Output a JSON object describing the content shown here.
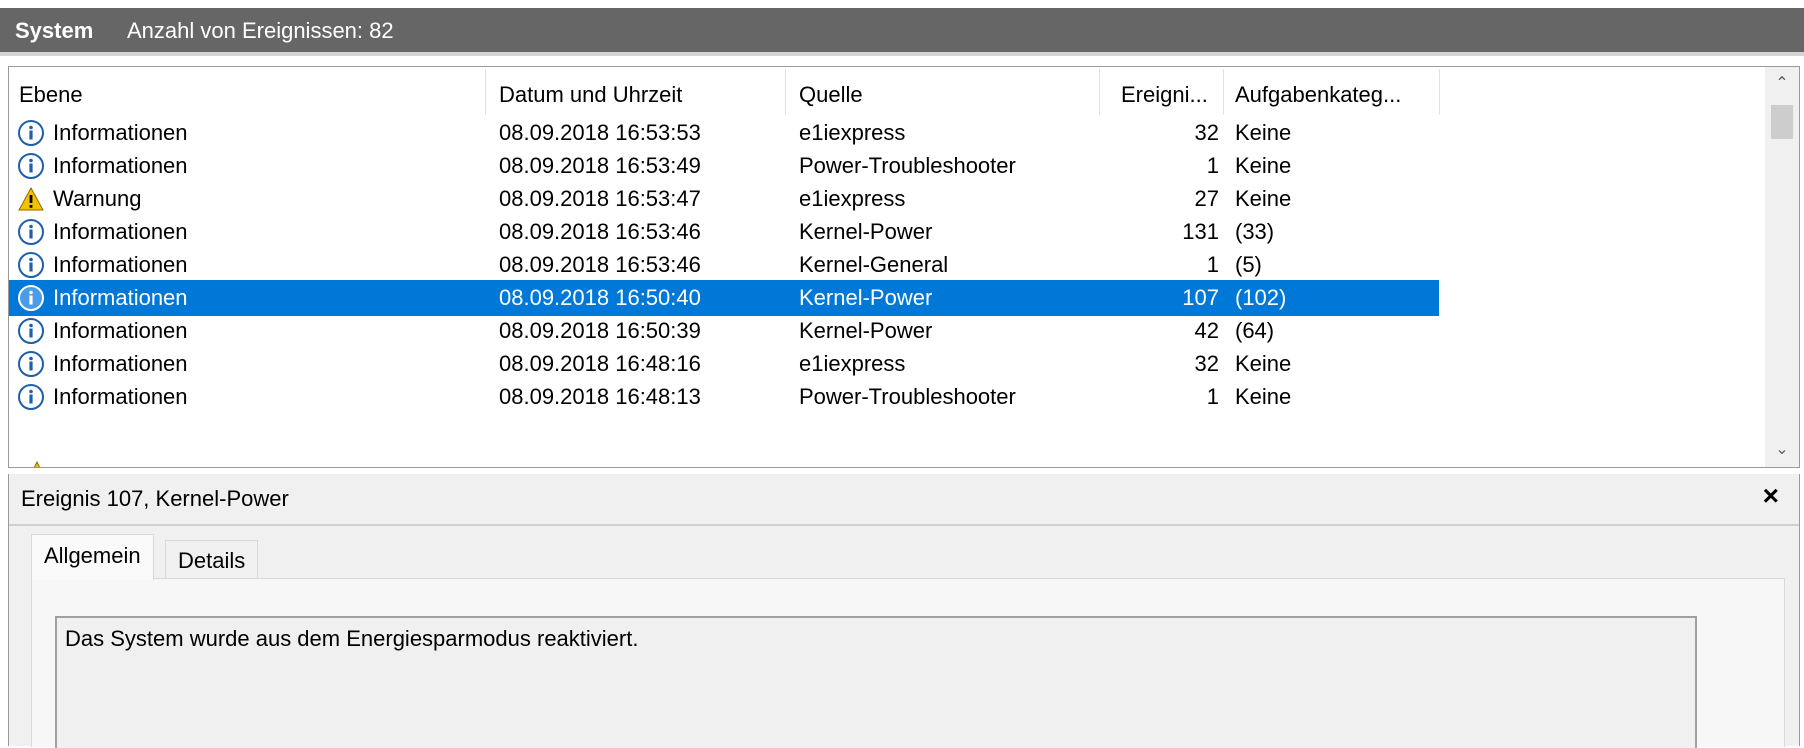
{
  "header": {
    "title": "System",
    "count": "Anzahl von Ereignissen: 82"
  },
  "columns": {
    "level": "Ebene",
    "date": "Datum und Uhrzeit",
    "source": "Quelle",
    "id": "Ereigni...",
    "task": "Aufgabenkateg..."
  },
  "events": [
    {
      "level": "Informationen",
      "date": "08.09.2018 16:53:53",
      "source": "e1iexpress",
      "id": "32",
      "task": "Keine",
      "icon": "info-icon"
    },
    {
      "level": "Informationen",
      "date": "08.09.2018 16:53:49",
      "source": "Power-Troubleshooter",
      "id": "1",
      "task": "Keine",
      "icon": "info-icon"
    },
    {
      "level": "Warnung",
      "date": "08.09.2018 16:53:47",
      "source": "e1iexpress",
      "id": "27",
      "task": "Keine",
      "icon": "warning-icon"
    },
    {
      "level": "Informationen",
      "date": "08.09.2018 16:53:46",
      "source": "Kernel-Power",
      "id": "131",
      "task": "(33)",
      "icon": "info-icon"
    },
    {
      "level": "Informationen",
      "date": "08.09.2018 16:53:46",
      "source": "Kernel-General",
      "id": "1",
      "task": "(5)",
      "icon": "info-icon"
    },
    {
      "level": "Informationen",
      "date": "08.09.2018 16:50:40",
      "source": "Kernel-Power",
      "id": "107",
      "task": "(102)",
      "icon": "info-icon",
      "selected": true
    },
    {
      "level": "Informationen",
      "date": "08.09.2018 16:50:39",
      "source": "Kernel-Power",
      "id": "42",
      "task": "(64)",
      "icon": "info-icon"
    },
    {
      "level": "Informationen",
      "date": "08.09.2018 16:48:16",
      "source": "e1iexpress",
      "id": "32",
      "task": "Keine",
      "icon": "info-icon"
    },
    {
      "level": "Informationen",
      "date": "08.09.2018 16:48:13",
      "source": "Power-Troubleshooter",
      "id": "1",
      "task": "Keine",
      "icon": "info-icon"
    }
  ],
  "detail": {
    "title": "Ereignis 107, Kernel-Power",
    "close": "×",
    "tabs": {
      "general": "Allgemein",
      "details": "Details"
    },
    "message": "Das System wurde aus dem Energiesparmodus reaktiviert."
  },
  "colors": {
    "header_bg": "#666666",
    "selection": "#0078d7",
    "info_icon": "#1f5fa8",
    "warning_icon": "#f2c200"
  }
}
